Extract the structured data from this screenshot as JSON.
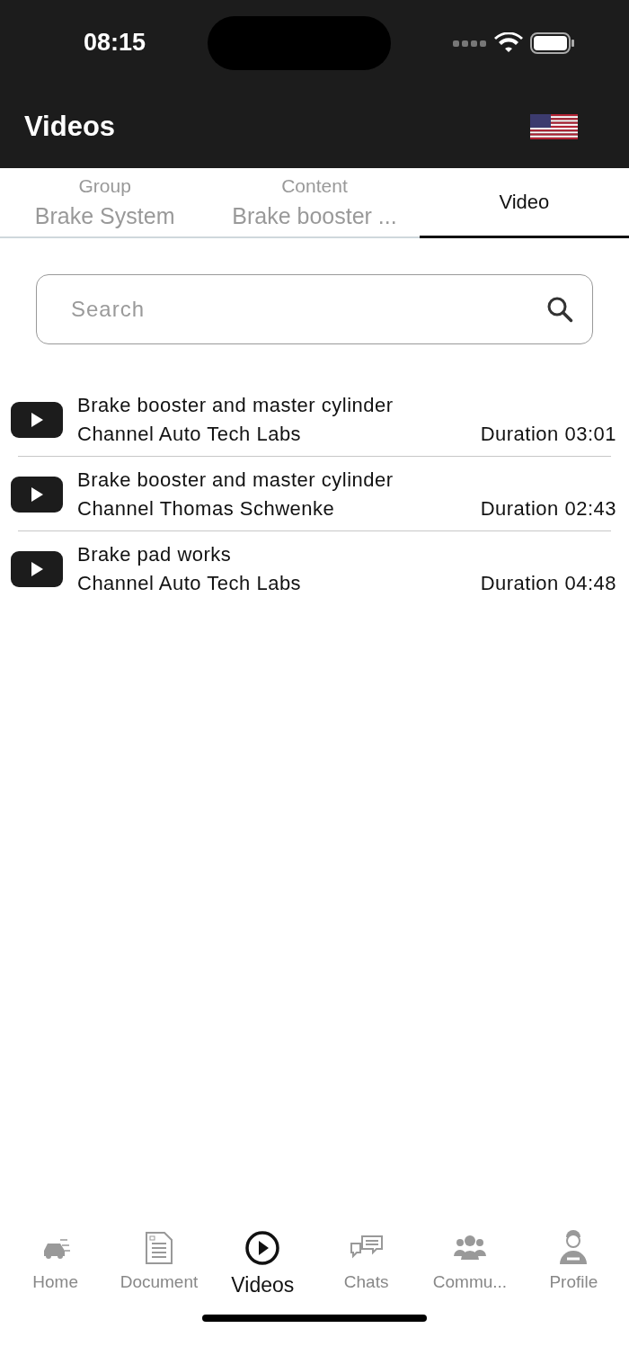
{
  "status_bar": {
    "time": "08:15"
  },
  "header": {
    "title": "Videos"
  },
  "tabs": [
    {
      "caption": "Group",
      "label": "Brake System",
      "selected": false
    },
    {
      "caption": "Content",
      "label": "Brake booster ...",
      "selected": false
    },
    {
      "label": "Video",
      "selected": true
    }
  ],
  "search": {
    "placeholder": "Search"
  },
  "videos": [
    {
      "title": "Brake booster and master cylinder",
      "channel": "Channel Auto Tech Labs",
      "duration": "Duration 03:01"
    },
    {
      "title": "Brake booster and master cylinder",
      "channel": "Channel Thomas Schwenke",
      "duration": "Duration 02:43"
    },
    {
      "title": "Brake pad works",
      "channel": "Channel Auto Tech Labs",
      "duration": "Duration 04:48"
    }
  ],
  "bottom_nav": [
    {
      "kind": "home",
      "label": "Home",
      "selected": false
    },
    {
      "kind": "document",
      "label": "Document",
      "selected": false
    },
    {
      "kind": "videos",
      "label": "Videos",
      "selected": true
    },
    {
      "kind": "chats",
      "label": "Chats",
      "selected": false
    },
    {
      "kind": "community",
      "label": "Commu...",
      "selected": false
    },
    {
      "kind": "profile",
      "label": "Profile",
      "selected": false
    }
  ]
}
